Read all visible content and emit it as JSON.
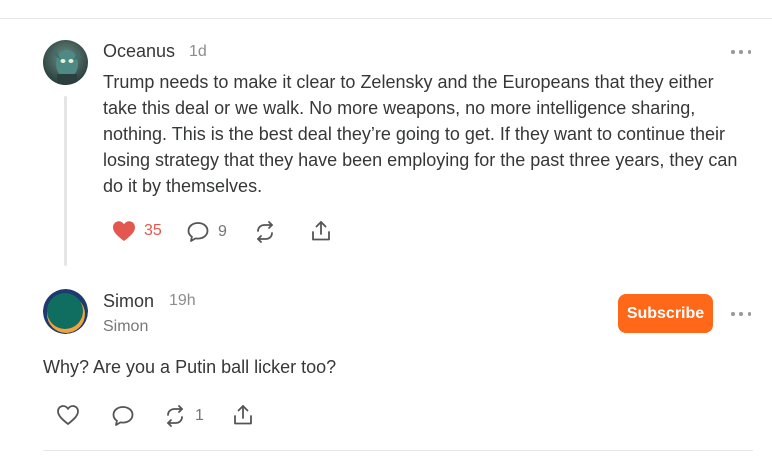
{
  "comments": [
    {
      "author": "Oceanus",
      "time": "1d",
      "avatar_icon": "alien-portrait-avatar",
      "text": "Trump needs to make it clear to Zelensky and the Europeans that they either take this deal or we walk. No more weapons, no more intelligence sharing, nothing. This is the best deal they’re going to get. If they want to continue their losing strategy that they have been employing for the past three years, they can do it by themselves.",
      "actions": {
        "like_count": "35",
        "liked": true,
        "reply_count": "9"
      }
    },
    {
      "author": "Simon",
      "time": "19h",
      "handle": "Simon",
      "avatar_icon": "circle-gradient-avatar",
      "subscribe_label": "Subscribe",
      "text": "Why? Are you a Putin ball licker too?",
      "actions": {
        "restack_count": "1"
      }
    }
  ],
  "colors": {
    "accent": "#ff6719",
    "like_red": "#e4574e",
    "text": "#363737",
    "muted": "#8c8c8c"
  }
}
